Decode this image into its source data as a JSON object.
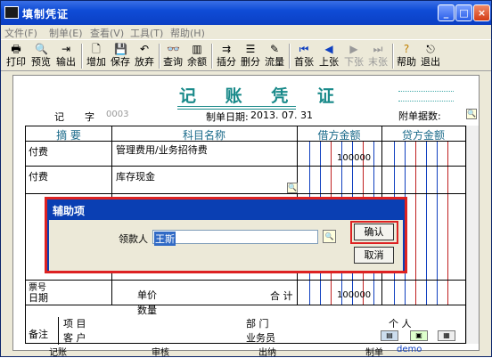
{
  "window": {
    "title": "填制凭证"
  },
  "menu": [
    "文件(F)",
    "制单(E)",
    "查看(V)",
    "工具(T)",
    "帮助(H)"
  ],
  "toolbar": {
    "print": "打印",
    "preview": "预览",
    "output": "输出",
    "add": "增加",
    "save": "保存",
    "discard": "放弃",
    "query": "查询",
    "balance": "余额",
    "insert": "插分",
    "delete": "删分",
    "flow": "流量",
    "first": "首张",
    "prev": "上张",
    "next": "下张",
    "last": "末张",
    "help": "帮助",
    "exit": "退出"
  },
  "voucher": {
    "title": "记 账 凭 证",
    "type_label": "记",
    "no_label": "字",
    "no_value": "0003",
    "date_label": "制单日期:",
    "date_value": "2013. 07. 31",
    "attach_label": "附单据数:",
    "headers": {
      "summary": "摘 要",
      "account": "科目名称",
      "debit": "借方金额",
      "credit": "贷方金额"
    },
    "rows": [
      {
        "summary": "付费",
        "account": "管理费用/业务招待费",
        "debit": "100000",
        "credit": ""
      },
      {
        "summary": "付费",
        "account": "库存现金",
        "debit": "",
        "credit": ""
      }
    ],
    "ticket_label": "票号",
    "date_row_label": "日期",
    "price_label": "单价",
    "qty_label": "数量",
    "total_label": "合 计",
    "total_debit": "100000",
    "note_label": "备注",
    "project_label": "项 目",
    "customer_label": "客 户",
    "dept_label": "部 门",
    "salesman_label": "业务员",
    "person_label": "个 人",
    "bottom": {
      "bookkeeper": "记账",
      "auditor": "审核",
      "cashier": "出纳",
      "maker_label": "制单",
      "maker": "demo"
    }
  },
  "dialog": {
    "title": "辅助项",
    "field_label": "领款人",
    "field_value": "王斯",
    "ok": "确认",
    "cancel": "取消"
  },
  "colors": {
    "accent": "#1a8a8a",
    "highlight": "#dd2222",
    "titlebar": "#0f4cd6"
  }
}
